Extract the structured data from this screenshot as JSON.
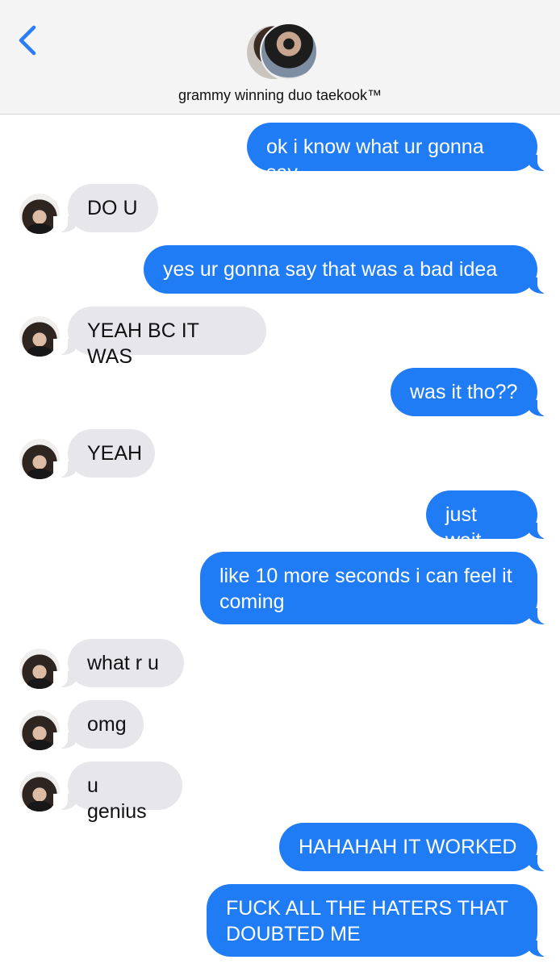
{
  "header": {
    "back_icon": "chevron-left-icon",
    "title": "grammy winning duo taekook™",
    "accent_color": "#2b7cf6"
  },
  "messages": [
    {
      "from": "me",
      "text": "ok i know what ur gonna say"
    },
    {
      "from": "them",
      "text": "DO U"
    },
    {
      "from": "me",
      "text": "yes ur gonna say that was a bad idea"
    },
    {
      "from": "them",
      "text": "YEAH BC IT WAS"
    },
    {
      "from": "me",
      "text": "was it tho??"
    },
    {
      "from": "them",
      "text": "YEAH"
    },
    {
      "from": "me",
      "text": "just wait"
    },
    {
      "from": "me",
      "text": "like 10 more seconds i can feel it coming"
    },
    {
      "from": "them",
      "text": "what r u"
    },
    {
      "from": "them",
      "text": "omg"
    },
    {
      "from": "them",
      "text": "u genius"
    },
    {
      "from": "me",
      "text": "HAHAHAH IT WORKED"
    },
    {
      "from": "me",
      "text": "FUCK ALL THE HATERS THAT DOUBTED ME"
    }
  ],
  "colors": {
    "sent_bubble": "#1f7cf5",
    "received_bubble": "#e7e6eb",
    "header_bg": "#f4f4f4"
  }
}
